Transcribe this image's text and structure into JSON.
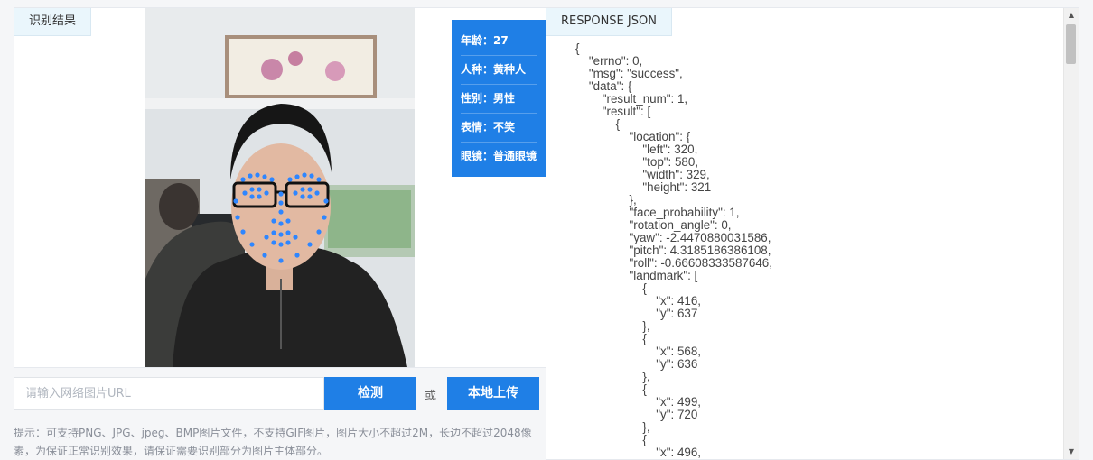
{
  "result_panel": {
    "tag": "识别结果"
  },
  "attributes": [
    {
      "label": "年龄",
      "value": "27"
    },
    {
      "label": "人种",
      "value": "黄种人"
    },
    {
      "label": "性别",
      "value": "男性"
    },
    {
      "label": "表情",
      "value": "不笑"
    },
    {
      "label": "眼镜",
      "value": "普通眼镜"
    }
  ],
  "attr_separator": "：",
  "url_input": {
    "placeholder": "请输入网络图片URL",
    "value": ""
  },
  "detect_button": "检测",
  "or_text": "或",
  "upload_button": "本地上传",
  "hint": "提示：可支持PNG、JPG、jpeg、BMP图片文件，不支持GIF图片，图片大小不超过2M，长边不超过2048像素，为保证正常识别效果，请保证需要识别部分为图片主体部分。",
  "json_panel": {
    "tag": "RESPONSE JSON",
    "content": "{\n\t\"errno\": 0,\n\t\"msg\": \"success\",\n\t\"data\": {\n\t\t\"result_num\": 1,\n\t\t\"result\": [\n\t\t\t{\n\t\t\t\t\"location\": {\n\t\t\t\t\t\"left\": 320,\n\t\t\t\t\t\"top\": 580,\n\t\t\t\t\t\"width\": 329,\n\t\t\t\t\t\"height\": 321\n\t\t\t\t},\n\t\t\t\t\"face_probability\": 1,\n\t\t\t\t\"rotation_angle\": 0,\n\t\t\t\t\"yaw\": -2.4470880031586,\n\t\t\t\t\"pitch\": 4.3185186386108,\n\t\t\t\t\"roll\": -0.66608333587646,\n\t\t\t\t\"landmark\": [\n\t\t\t\t\t{\n\t\t\t\t\t\t\"x\": 416,\n\t\t\t\t\t\t\"y\": 637\n\t\t\t\t\t},\n\t\t\t\t\t{\n\t\t\t\t\t\t\"x\": 568,\n\t\t\t\t\t\t\"y\": 636\n\t\t\t\t\t},\n\t\t\t\t\t{\n\t\t\t\t\t\t\"x\": 499,\n\t\t\t\t\t\t\"y\": 720\n\t\t\t\t\t},\n\t\t\t\t\t{\n\t\t\t\t\t\t\"x\": 496,"
  },
  "colors": {
    "accent": "#1f7fe6",
    "landmark": "#2e86ff",
    "tag_bg": "#eaf6fc"
  }
}
